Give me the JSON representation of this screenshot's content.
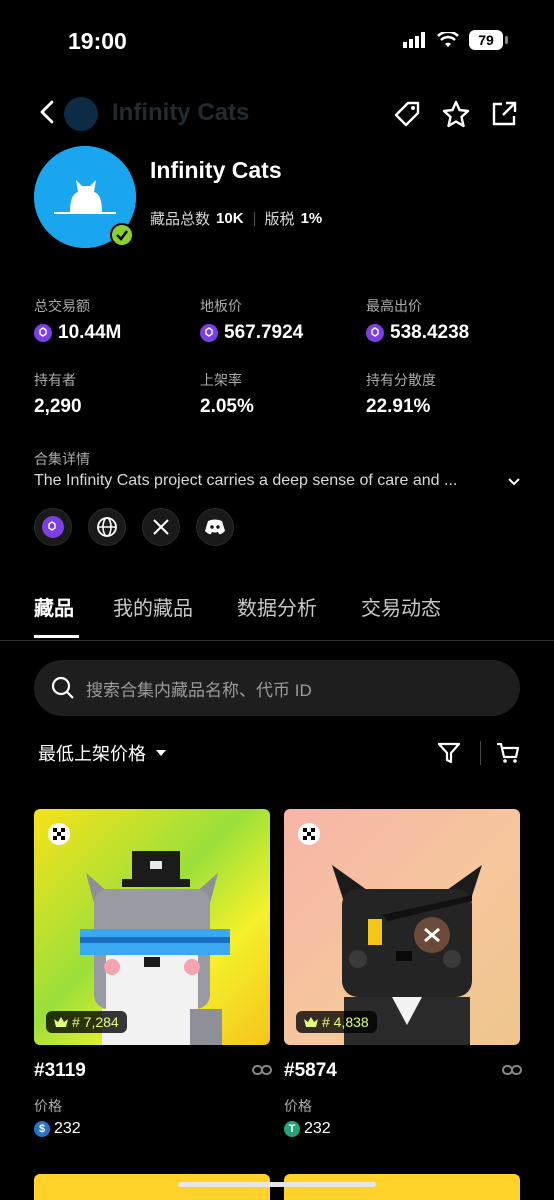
{
  "status_bar": {
    "time": "19:00",
    "battery": "79"
  },
  "header": {
    "title": "Infinity Cats"
  },
  "collection": {
    "name": "Infinity Cats",
    "items_label": "藏品总数",
    "items_value": "10K",
    "royalty_label": "版税",
    "royalty_value": "1%"
  },
  "stats": [
    {
      "label": "总交易额",
      "value": "10.44M",
      "icon": "polygon-coin-icon"
    },
    {
      "label": "地板价",
      "value": "567.7924",
      "icon": "polygon-coin-icon"
    },
    {
      "label": "最高出价",
      "value": "538.4238",
      "icon": "polygon-coin-icon"
    },
    {
      "label": "持有者",
      "value": "2,290"
    },
    {
      "label": "上架率",
      "value": "2.05%"
    },
    {
      "label": "持有分散度",
      "value": "22.91%"
    }
  ],
  "description": {
    "label": "合集详情",
    "text": "The Infinity Cats project carries a deep sense of care and ..."
  },
  "social_icons": [
    "polygon-icon",
    "globe-icon",
    "x-icon",
    "discord-icon"
  ],
  "tabs": [
    {
      "label": "藏品",
      "active": true
    },
    {
      "label": "我的藏品",
      "active": false
    },
    {
      "label": "数据分析",
      "active": false
    },
    {
      "label": "交易动态",
      "active": false
    }
  ],
  "search": {
    "placeholder": "搜索合集内藏品名称、代币 ID"
  },
  "sort": {
    "label": "最低上架价格"
  },
  "cards": [
    {
      "id": "#3119",
      "rank": "# 7,284",
      "price_label": "价格",
      "price": "232",
      "coin": "usdc-icon"
    },
    {
      "id": "#5874",
      "rank": "# 4,838",
      "price_label": "价格",
      "price": "232",
      "coin": "usdt-icon"
    }
  ]
}
